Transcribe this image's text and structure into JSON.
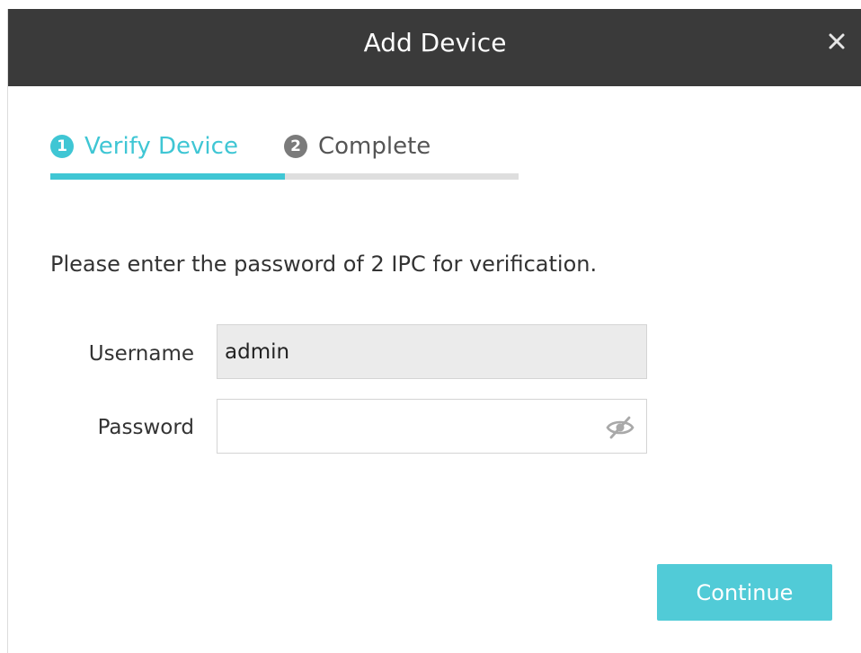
{
  "dialog": {
    "title": "Add Device",
    "close_icon": "close-icon"
  },
  "steps": [
    {
      "number": "1",
      "label": "Verify Device",
      "active": true
    },
    {
      "number": "2",
      "label": "Complete",
      "active": false
    }
  ],
  "progress": {
    "fraction": 0.5
  },
  "instruction": "Please enter the password of 2 IPC for verification.",
  "form": {
    "username_label": "Username",
    "username_value": "admin",
    "password_label": "Password",
    "password_value": "",
    "password_toggle_icon": "eye-slash-icon"
  },
  "buttons": {
    "continue_label": "Continue"
  },
  "colors": {
    "accent": "#3fc6d4",
    "titlebar": "#3a3a3a",
    "button": "#51cbd7",
    "inactive_step": "#7b7b7b"
  }
}
